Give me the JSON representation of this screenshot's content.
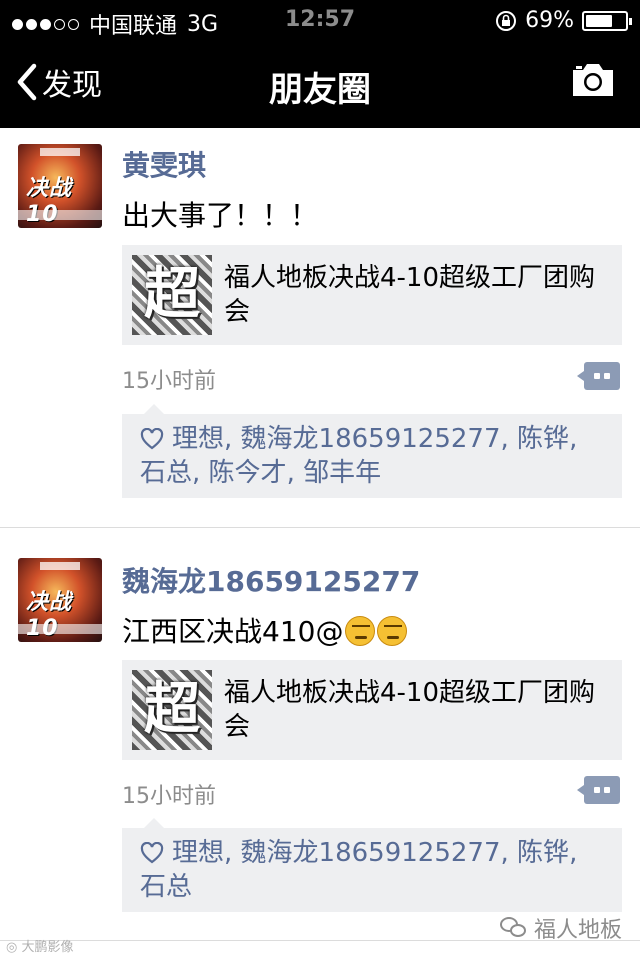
{
  "status_bar": {
    "carrier": "中国联通",
    "network": "3G",
    "time": "12:57",
    "battery": "69%",
    "battery_level": 0.69,
    "signal_dots": [
      true,
      true,
      true,
      false,
      false
    ]
  },
  "nav": {
    "back_label": "发现",
    "title": "朋友圈"
  },
  "posts": [
    {
      "name": "黄雯琪",
      "text": "出大事了！！！",
      "link_title": "福人地板决战4-10超级工厂团购会",
      "time": "15小时前",
      "likes": [
        "理想",
        "魏海龙18659125277",
        "陈铧",
        "石总",
        "陈今才",
        "邹丰年"
      ]
    },
    {
      "name": "魏海龙18659125277",
      "text": "江西区决战410@",
      "link_title": "福人地板决战4-10超级工厂团购会",
      "time": "15小时前",
      "likes": [
        "理想",
        "魏海龙18659125277",
        "陈铧",
        "石总"
      ]
    }
  ],
  "avatar_text": "决战10",
  "thumb_text": "超",
  "watermarks": {
    "left": "大鹏影像",
    "right": "福人地板"
  },
  "colors": {
    "name_link": "#576b95",
    "nav_bg": "#000000",
    "card_bg": "#eeeff1",
    "timestamp": "#8c8c8c"
  },
  "icons": [
    "back-chevron-icon",
    "camera-icon",
    "comment-icon",
    "heart-icon",
    "wechat-icon",
    "weibo-icon",
    "orientation-lock-icon"
  ]
}
